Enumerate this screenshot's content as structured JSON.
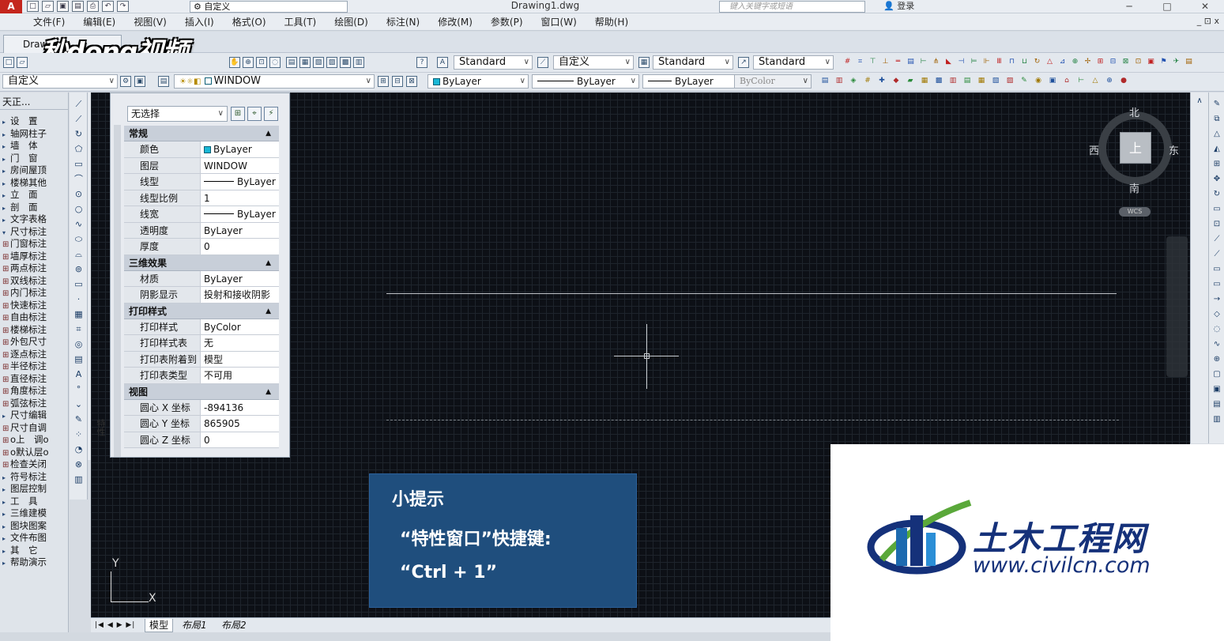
{
  "titlebar": {
    "logo": "A",
    "workspace": "自定义",
    "document": "Drawing1.dwg",
    "search_placeholder": "键入关键字或短语",
    "login": "登录",
    "minimize": "─",
    "maximize": "□",
    "close": "✕"
  },
  "menu": {
    "items": [
      "文件(F)",
      "编辑(E)",
      "视图(V)",
      "插入(I)",
      "格式(O)",
      "工具(T)",
      "绘图(D)",
      "标注(N)",
      "修改(M)",
      "参数(P)",
      "窗口(W)",
      "帮助(H)"
    ],
    "right": "_ ⊡ x"
  },
  "tabs": {
    "doc_tab": "Draw",
    "watermark": "秒dong视频"
  },
  "toolbar1": {
    "text_style": "Standard",
    "dim_style": "自定义",
    "table_style": "Standard",
    "multileader_style": "Standard"
  },
  "toolbar2": {
    "workspace": "自定义",
    "layer": "WINDOW",
    "color": "ByLayer",
    "linetype": "ByLayer",
    "lineweight": "ByLayer",
    "plotstyle": "ByColor"
  },
  "leftpanel": {
    "title": "天正...",
    "items": [
      {
        "mark": "▸",
        "label": "设　置"
      },
      {
        "mark": "▸",
        "label": "轴网柱子"
      },
      {
        "mark": "▸",
        "label": "墙　体"
      },
      {
        "mark": "▸",
        "label": "门　窗"
      },
      {
        "mark": "▸",
        "label": "房间屋顶"
      },
      {
        "mark": "▸",
        "label": "楼梯其他"
      },
      {
        "mark": "▸",
        "label": "立　面"
      },
      {
        "mark": "▸",
        "label": "剖　面"
      },
      {
        "mark": "▸",
        "label": "文字表格"
      },
      {
        "mark": "▾",
        "label": "尺寸标注"
      },
      {
        "mark": "⊞",
        "label": "门窗标注",
        "sub": true
      },
      {
        "mark": "⊞",
        "label": "墙厚标注",
        "sub": true
      },
      {
        "mark": "⊞",
        "label": "两点标注",
        "sub": true
      },
      {
        "mark": "⊞",
        "label": "双线标注",
        "sub": true
      },
      {
        "mark": "⊞",
        "label": "内门标注",
        "sub": true
      },
      {
        "mark": "⊞",
        "label": "快速标注",
        "sub": true
      },
      {
        "mark": "⊞",
        "label": "自由标注",
        "sub": true
      },
      {
        "mark": "⊞",
        "label": "楼梯标注",
        "sub": true
      },
      {
        "mark": "⊞",
        "label": "外包尺寸",
        "sub": true
      },
      {
        "mark": "⊞",
        "label": "逐点标注",
        "sub": true
      },
      {
        "mark": "⊞",
        "label": "半径标注",
        "sub": true
      },
      {
        "mark": "⊞",
        "label": "直径标注",
        "sub": true
      },
      {
        "mark": "⊞",
        "label": "角度标注",
        "sub": true
      },
      {
        "mark": "⊞",
        "label": "弧弦标注",
        "sub": true
      },
      {
        "mark": "▸",
        "label": "尺寸编辑"
      },
      {
        "mark": "⊞",
        "label": "尺寸自调",
        "sub": true
      },
      {
        "mark": "⊞",
        "label": "o上　调o",
        "sub": true
      },
      {
        "mark": "⊞",
        "label": "o默认层o",
        "sub": true
      },
      {
        "mark": "⊞",
        "label": "检查关闭",
        "sub": true
      },
      {
        "mark": "▸",
        "label": "符号标注"
      },
      {
        "mark": "▸",
        "label": "图层控制"
      },
      {
        "mark": "▸",
        "label": "工　具"
      },
      {
        "mark": "▸",
        "label": "三维建模"
      },
      {
        "mark": "▸",
        "label": "图块图案"
      },
      {
        "mark": "▸",
        "label": "文件布图"
      },
      {
        "mark": "▸",
        "label": "其　它"
      },
      {
        "mark": "▸",
        "label": "帮助演示"
      }
    ]
  },
  "properties": {
    "selection": "无选择",
    "side_label": "特性",
    "categories": [
      {
        "name": "常规",
        "rows": [
          {
            "key": "颜色",
            "value": "ByLayer",
            "swatch": true
          },
          {
            "key": "图层",
            "value": "WINDOW"
          },
          {
            "key": "线型",
            "value": "ByLayer",
            "line": true
          },
          {
            "key": "线型比例",
            "value": "1"
          },
          {
            "key": "线宽",
            "value": "ByLayer",
            "line": true
          },
          {
            "key": "透明度",
            "value": "ByLayer"
          },
          {
            "key": "厚度",
            "value": "0"
          }
        ]
      },
      {
        "name": "三维效果",
        "rows": [
          {
            "key": "材质",
            "value": "ByLayer"
          },
          {
            "key": "阴影显示",
            "value": "投射和接收阴影"
          }
        ]
      },
      {
        "name": "打印样式",
        "rows": [
          {
            "key": "打印样式",
            "value": "ByColor"
          },
          {
            "key": "打印样式表",
            "value": "无"
          },
          {
            "key": "打印表附着到",
            "value": "模型"
          },
          {
            "key": "打印表类型",
            "value": "不可用"
          }
        ]
      },
      {
        "name": "视图",
        "rows": [
          {
            "key": "圆心 X 坐标",
            "value": "-894136"
          },
          {
            "key": "圆心 Y 坐标",
            "value": "865905"
          },
          {
            "key": "圆心 Z 坐标",
            "value": "0"
          }
        ]
      }
    ]
  },
  "viewcube": {
    "north": "北",
    "south": "南",
    "west": "西",
    "east": "东",
    "face": "上",
    "wcs": "WCS"
  },
  "ucs": {
    "x": "X",
    "y": "Y"
  },
  "tip": {
    "title": "小提示",
    "line1": "“特性窗口”快捷键:",
    "line2": "“Ctrl + 1”"
  },
  "layout_tabs": {
    "nav": "|◀ ◀ ▶ ▶|",
    "model": "模型",
    "layout1": "布局1",
    "layout2": "布局2"
  },
  "brand": {
    "cn": "土木工程网",
    "url": "www.civilcn.com",
    "colors": {
      "blue": "#15317a",
      "green": "#5aa83a"
    }
  }
}
